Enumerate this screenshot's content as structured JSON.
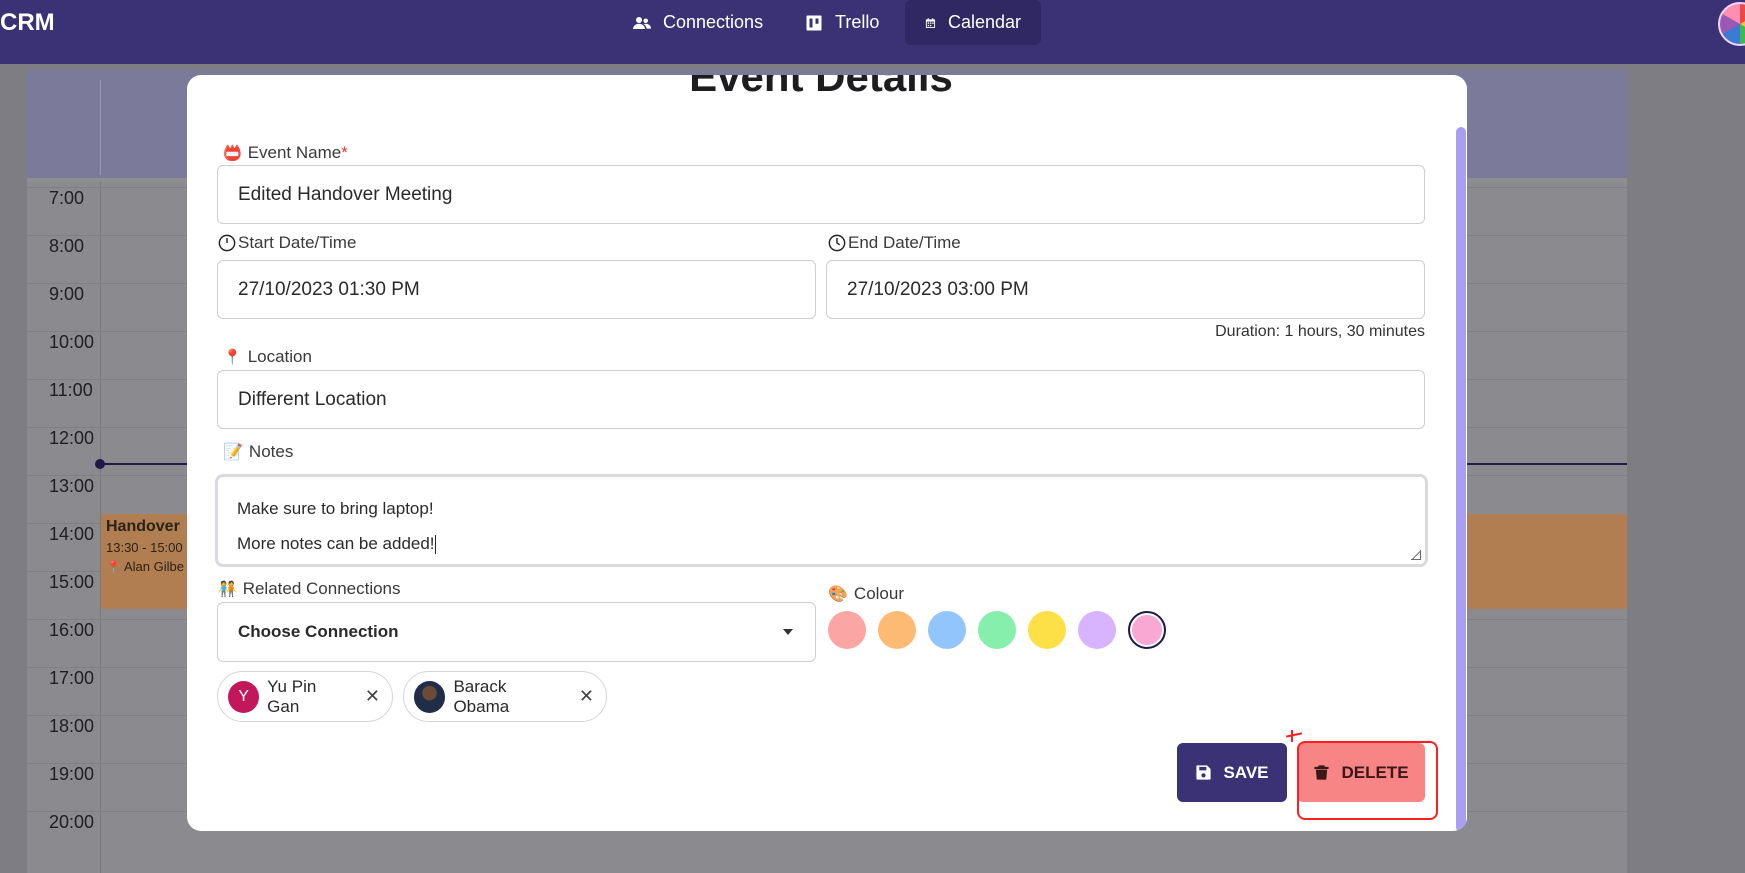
{
  "navbar": {
    "brand": "CRM",
    "items": [
      {
        "label": "Connections",
        "icon": "users-icon"
      },
      {
        "label": "Trello",
        "icon": "trello-icon"
      },
      {
        "label": "Calendar",
        "icon": "calendar-icon",
        "active": true
      }
    ],
    "background": "#3b3275"
  },
  "calendar": {
    "hours": [
      "7:00",
      "8:00",
      "9:00",
      "10:00",
      "11:00",
      "12:00",
      "13:00",
      "14:00",
      "15:00",
      "16:00",
      "17:00",
      "18:00",
      "19:00",
      "20:00"
    ],
    "event": {
      "title": "Handover",
      "time": "13:30 - 15:00",
      "location": "Alan Gilbe"
    }
  },
  "modal": {
    "title": "Event Details",
    "event_name": {
      "label": "Event Name",
      "required_mark": "*",
      "value": "Edited Handover Meeting",
      "icon": "calendar-emoji-icon"
    },
    "start": {
      "label": "Start Date/Time",
      "value": "27/10/2023 01:30 PM",
      "icon": "clock-icon"
    },
    "end": {
      "label": "End Date/Time",
      "value": "27/10/2023 03:00 PM",
      "icon": "clock-icon"
    },
    "duration": "Duration: 1 hours, 30 minutes",
    "location": {
      "label": "Location",
      "value": "Different Location",
      "icon": "pin-icon"
    },
    "notes": {
      "label": "Notes",
      "lines": [
        "Make sure to bring laptop!",
        "More notes can be added!"
      ],
      "icon": "memo-icon"
    },
    "related": {
      "label": "Related Connections",
      "placeholder": "Choose Connection",
      "icon": "people-icon"
    },
    "colour": {
      "label": "Colour",
      "icon": "palette-icon",
      "swatches": [
        "#fca5a5",
        "#fdba74",
        "#93c5fd",
        "#86efac",
        "#fde047",
        "#d8b4fe",
        "#f9a8d4"
      ],
      "selected_index": 6
    },
    "chips": [
      {
        "initial": "Y",
        "name": "Yu Pin Gan",
        "avatar_color": "#c2185b"
      },
      {
        "initial": "",
        "name": "Barack Obama",
        "avatar_color": "#2b3a55"
      }
    ],
    "buttons": {
      "save": "SAVE",
      "delete": "DELETE"
    }
  }
}
